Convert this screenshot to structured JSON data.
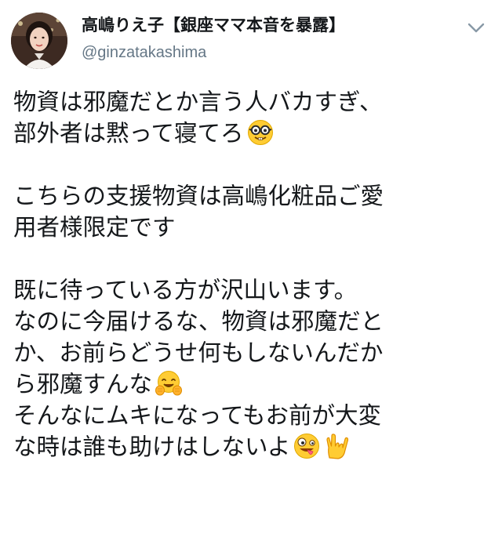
{
  "author": {
    "display_name": "高嶋りえ子【銀座ママ本音を暴露】",
    "handle": "@ginzatakashima"
  },
  "tweet": {
    "lines": [
      "物資は邪魔だとか言う人バカすぎ、",
      "部外者は黙って寝てろ",
      "",
      "こちらの支援物資は高嶋化粧品ご愛",
      "用者様限定です",
      "",
      "既に待っている方が沢山います。",
      "なのに今届けるな、物資は邪魔だと",
      "か、お前らどうせ何もしないんだか",
      "ら邪魔すんな",
      "そんなにムキになってもお前が大変",
      "な時は誰も助けはしないよ"
    ],
    "emojis": {
      "line_2": "nerd-face-emoji",
      "line_10": "hugging-face-emoji",
      "line_12": [
        "zany-face-emoji",
        "love-you-gesture-emoji"
      ]
    }
  },
  "icons": {
    "more_menu": "chevron-down-icon"
  },
  "colors": {
    "text": "#14171a",
    "secondary": "#657786",
    "caret": "#8899a6"
  }
}
